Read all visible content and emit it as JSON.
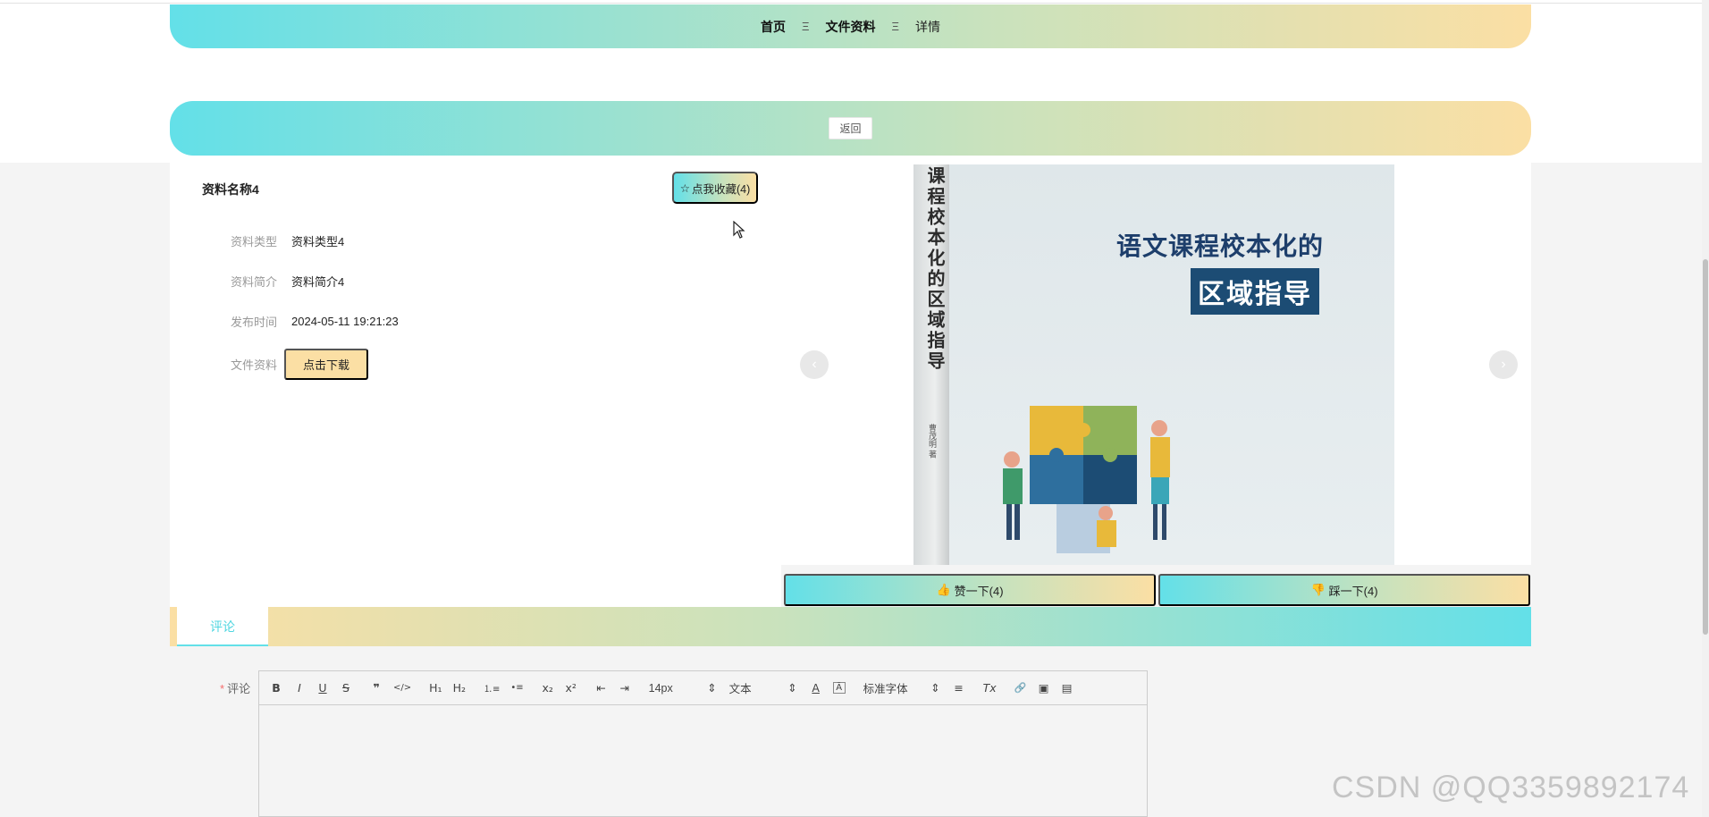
{
  "breadcrumb": {
    "items": [
      "首页",
      "文件资料",
      "详情"
    ],
    "separator": "Ξ"
  },
  "back_button": "返回",
  "resource": {
    "name": "资料名称4",
    "favorite_label": "点我收藏(4)",
    "fields": [
      {
        "label": "资料类型",
        "value": "资料类型4"
      },
      {
        "label": "资料简介",
        "value": "资料简介4"
      },
      {
        "label": "发布时间",
        "value": "2024-05-11 19:21:23"
      },
      {
        "label": "文件资料",
        "button": "点击下载"
      }
    ]
  },
  "cover": {
    "spine_title": "课程校本化的区域指导",
    "spine_author": "曹茂明 著",
    "title_line1": "语文课程校本化的",
    "title_line2": "区域指导"
  },
  "votes": {
    "like": "赞一下(4)",
    "dislike": "踩一下(4)"
  },
  "tabs": {
    "comment": "评论"
  },
  "comment_form": {
    "label": "评论",
    "required_mark": "*",
    "toolbar": {
      "bold": "B",
      "italic": "I",
      "underline": "U",
      "strike": "S",
      "quote": "❞",
      "code": "</>",
      "h1": "H₁",
      "h2": "H₂",
      "ordered_list": "⒈≡",
      "bullet_list": "•≡",
      "sub": "x₂",
      "sup": "x²",
      "outdent": "⇤",
      "indent": "⇥",
      "size": "14px",
      "format": "文本",
      "font": "标准字体",
      "color": "A",
      "background": "Ā",
      "align": "≡",
      "clean": "Tx",
      "link": "🔗",
      "image": "▣",
      "video": "▤"
    }
  },
  "watermark": "CSDN @QQ3359892174",
  "colors": {
    "gradient_start": "#63e0e8",
    "gradient_mid": "#c9e2bd",
    "gradient_end": "#fbdfa4",
    "tab_active": "#4fd6e0",
    "cover_navy": "#1c4c74"
  }
}
